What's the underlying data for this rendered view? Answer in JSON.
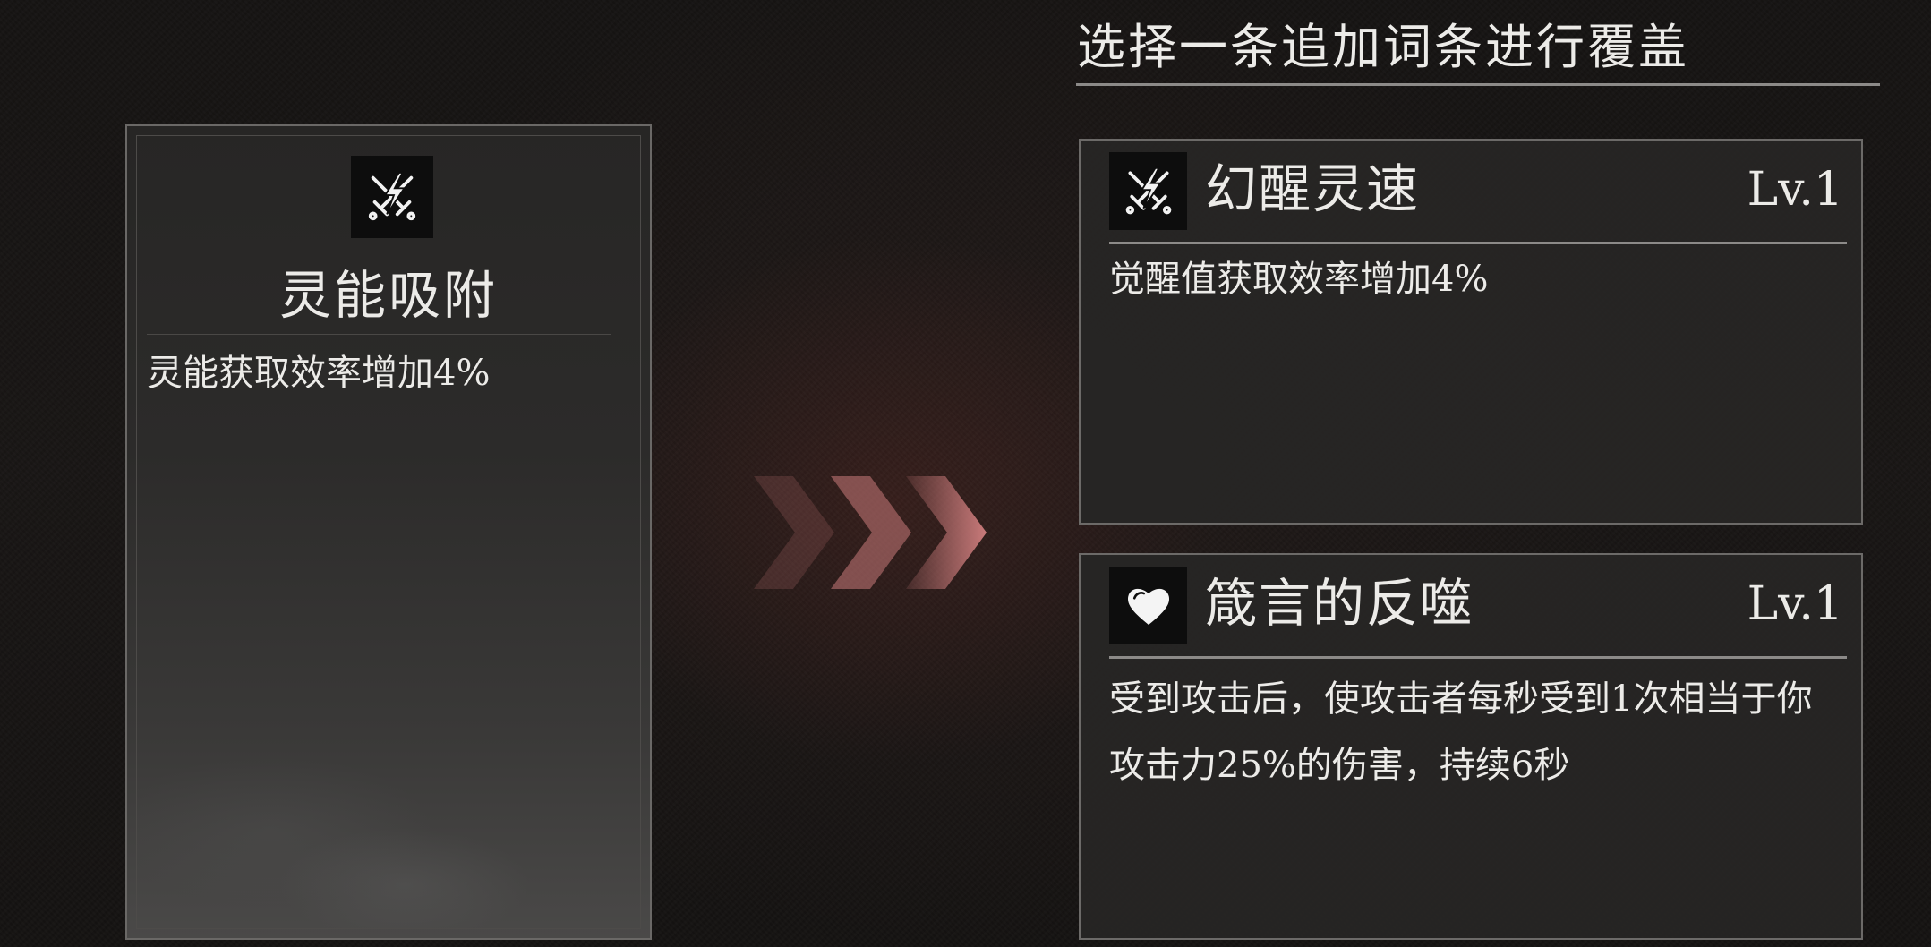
{
  "header": {
    "title": "选择一条追加词条进行覆盖"
  },
  "current_entry": {
    "icon": "crossed-swords-lightning-icon",
    "name": "灵能吸附",
    "description": "灵能获取效率增加4%"
  },
  "transition": {
    "icon": "triple-chevron-right-icon",
    "color": "#c97a7a"
  },
  "options": [
    {
      "icon": "crossed-swords-lightning-icon",
      "name": "幻醒灵速",
      "level": "Lv.1",
      "description": "觉醒值获取效率增加4%"
    },
    {
      "icon": "heart-icon",
      "name": "箴言的反噬",
      "level": "Lv.1",
      "description": "受到攻击后，使攻击者每秒受到1次相当于你攻击力25%的伤害，持续6秒"
    }
  ],
  "colors": {
    "background": "#131110",
    "card": "#262524",
    "text": "#ecebe8",
    "border": "#6c6a68"
  }
}
